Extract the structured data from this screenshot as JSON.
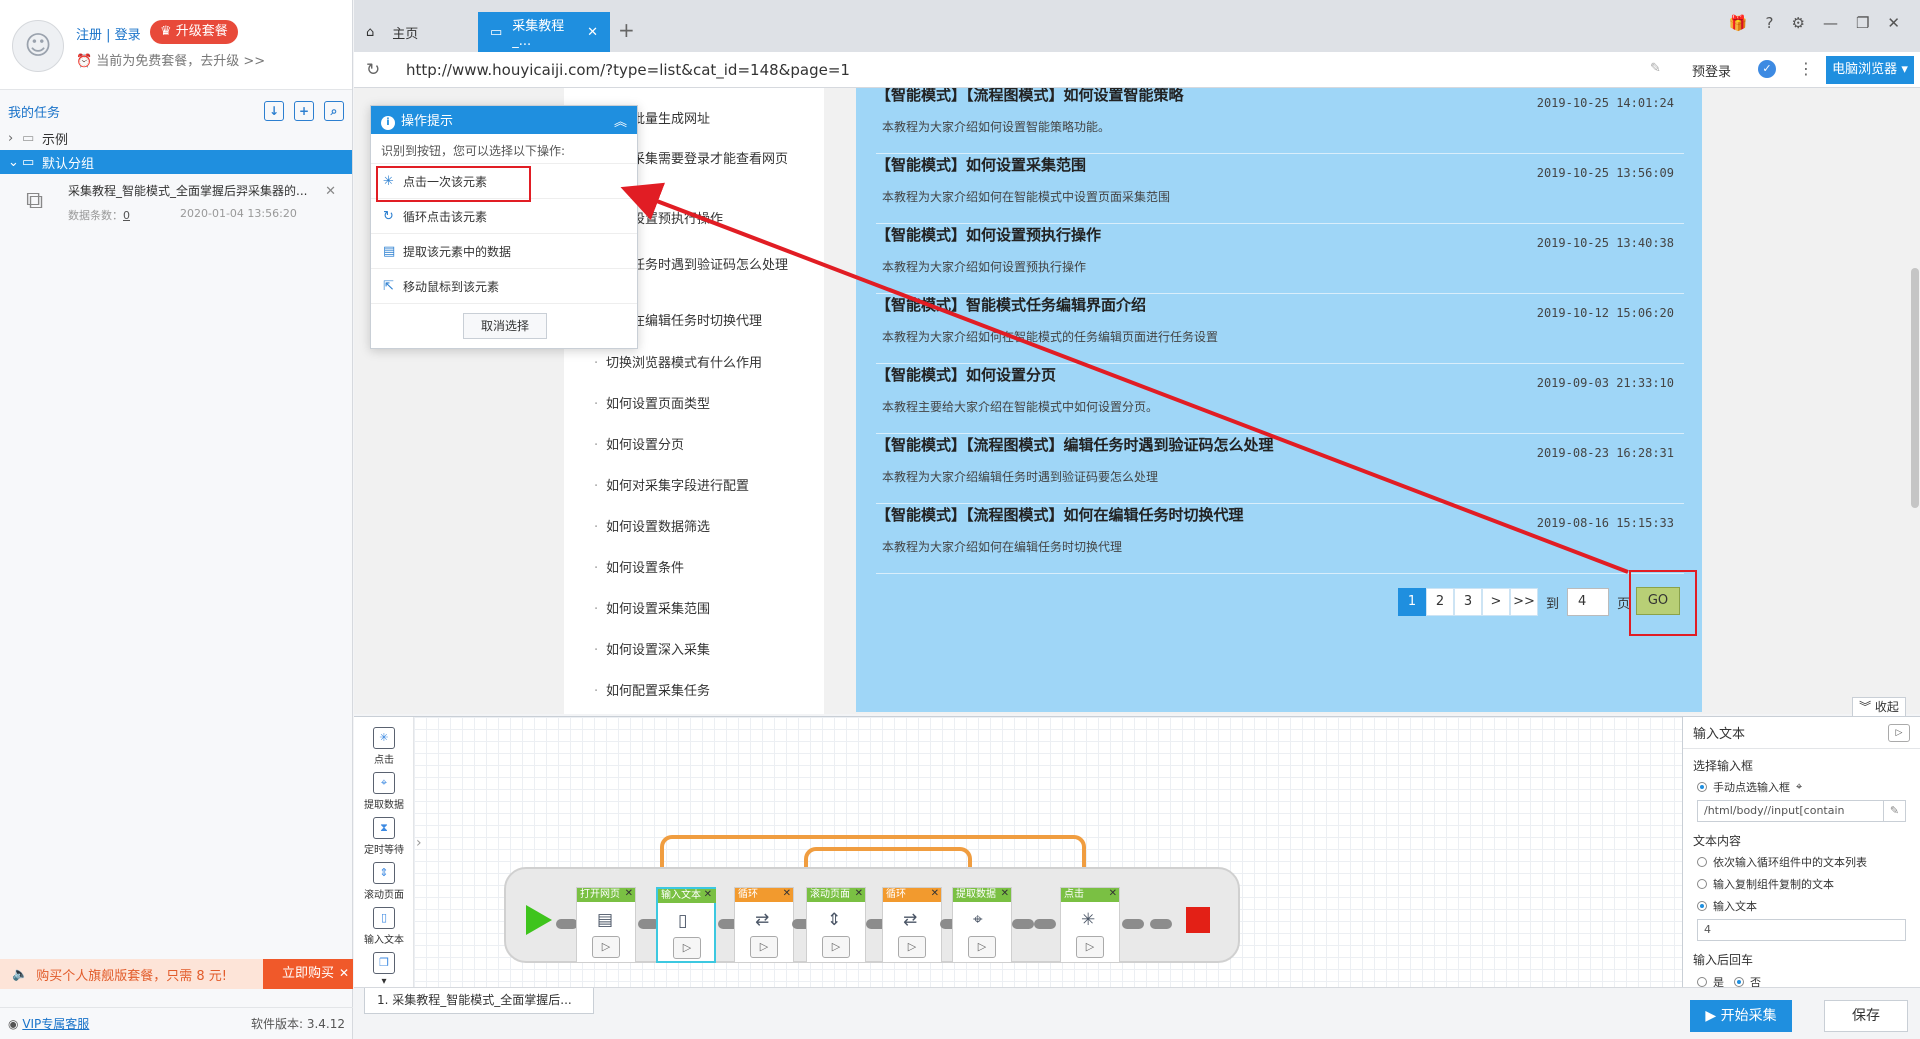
{
  "sidebar": {
    "register_label": "注册",
    "separator": " | ",
    "login_label": "登录",
    "upgrade_label": "升级套餐",
    "plan_note": "当前为免费套餐，去升级 >>",
    "tasks_title": "我的任务",
    "tree": [
      {
        "label": "示例",
        "arrow": "›"
      },
      {
        "label": "默认分组",
        "arrow": "⌄"
      }
    ],
    "task": {
      "name": "采集教程_智能模式_全面掌握后羿采集器的...",
      "count_label": "数据条数：",
      "count_value": "0",
      "date": "2020-01-04 13:56:20"
    },
    "promo_text": "购买个人旗舰版套餐，只需 8 元!",
    "buy_label": "立即购买",
    "vip_label": "VIP专属客服",
    "version_label": "软件版本: 3.4.12"
  },
  "browser": {
    "tabs": [
      {
        "label": "主页"
      },
      {
        "label": "采集教程_..."
      }
    ],
    "url": "http://www.houyicaiji.com/?type=list&cat_id=148&page=1",
    "pre_login": "预登录",
    "pc_browser": "电脑浏览器"
  },
  "articles": [
    "如何批量生成网址",
    "如何采集需要登录才能查看网页",
    "如何设置预执行操作",
    "编辑任务时遇到验证码怎么处理",
    "如何在编辑任务时切换代理",
    "切换浏览器模式有什么作用",
    "如何设置页面类型",
    "如何设置分页",
    "如何对采集字段进行配置",
    "如何设置数据筛选",
    "如何设置条件",
    "如何设置采集范围",
    "如何设置深入采集",
    "如何配置采集任务"
  ],
  "entries": [
    {
      "title": "【智能模式】【流程图模式】如何设置智能策略",
      "desc": "本教程为大家介绍如何设置智能策略功能。",
      "date": "2019-10-25 14:01:24"
    },
    {
      "title": "【智能模式】如何设置采集范围",
      "desc": "本教程为大家介绍如何在智能模式中设置页面采集范围",
      "date": "2019-10-25 13:56:09"
    },
    {
      "title": "【智能模式】如何设置预执行操作",
      "desc": "本教程为大家介绍如何设置预执行操作",
      "date": "2019-10-25 13:40:38"
    },
    {
      "title": "【智能模式】智能模式任务编辑界面介绍",
      "desc": "本教程为大家介绍如何在智能模式的任务编辑页面进行任务设置",
      "date": "2019-10-12 15:06:20"
    },
    {
      "title": "【智能模式】如何设置分页",
      "desc": "本教程主要给大家介绍在智能模式中如何设置分页。",
      "date": "2019-09-03 21:33:10"
    },
    {
      "title": "【智能模式】【流程图模式】编辑任务时遇到验证码怎么处理",
      "desc": "本教程为大家介绍编辑任务时遇到验证码要怎么处理",
      "date": "2019-08-23 16:28:31"
    },
    {
      "title": "【智能模式】【流程图模式】如何在编辑任务时切换代理",
      "desc": "本教程为大家介绍如何在编辑任务时切换代理",
      "date": "2019-08-16 15:15:33"
    }
  ],
  "pager": {
    "pages": [
      "1",
      "2",
      "3",
      ">",
      ">>"
    ],
    "to_label": "到",
    "page_value": "4",
    "unit_label": "页",
    "go_label": "GO"
  },
  "tip": {
    "title": "操作提示",
    "desc": "识别到按钮，您可以选择以下操作:",
    "options": [
      "点击一次该元素",
      "循环点击该元素",
      "提取该元素中的数据",
      "移动鼠标到该元素"
    ],
    "cancel_label": "取消选择"
  },
  "designer": {
    "collapse_label": "收起",
    "tools": [
      "点击",
      "提取数据",
      "定时等待",
      "滚动页面",
      "输入文本"
    ],
    "nodes": [
      "打开网页",
      "输入文本",
      "循环",
      "滚动页面",
      "循环",
      "提取数据",
      "点击"
    ]
  },
  "props": {
    "title": "输入文本",
    "select_input_label": "选择输入框",
    "manual_select": "手动点选输入框",
    "xpath_value": "/html/body//input[contain",
    "text_content_label": "文本内容",
    "opt_loop": "依次输入循环组件中的文本列表",
    "opt_copy": "输入复制组件复制的文本",
    "opt_text": "输入文本",
    "text_value": "4",
    "enter_label": "输入后回车",
    "yes_label": "是",
    "no_label": "否"
  },
  "bottom": {
    "task_tab": "1. 采集教程_智能模式_全面掌握后...",
    "start_label": "开始采集",
    "save_label": "保存"
  },
  "colors": {
    "accent": "#1f8fdf",
    "content_bg": "#9fd6f7",
    "highlight_red": "#e11d24",
    "node_green": "#7ac043",
    "node_orange": "#f29a2e"
  }
}
